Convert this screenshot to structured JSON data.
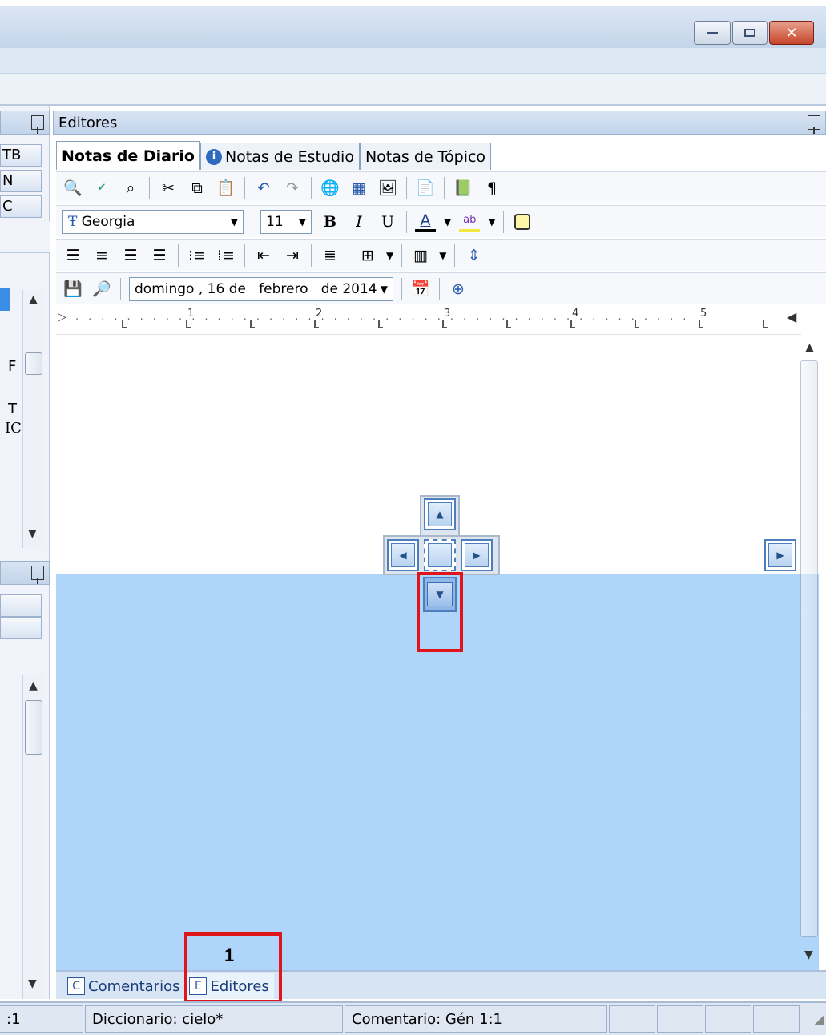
{
  "window": {
    "minimize_icon": "minimize-icon",
    "restore_icon": "restore-icon",
    "close_icon": "close-icon"
  },
  "left_pane": {
    "buttons": [
      "TB",
      "N",
      "C"
    ],
    "partial_text": [
      "F",
      "T",
      "IC"
    ]
  },
  "editors_pane": {
    "title": "Editores",
    "tabs": [
      {
        "label": "Notas de Diario",
        "active": true
      },
      {
        "label": "Notas de Estudio",
        "icon": "info-icon"
      },
      {
        "label": "Notas de Tópico"
      }
    ],
    "font_name": "Georgia",
    "font_size": "11",
    "bold": "B",
    "italic": "I",
    "underline": "U",
    "font_color": "A",
    "highlight": "ab",
    "pilcrow": "¶",
    "date_value": "domingo , 16 de   febrero   de 2014",
    "ruler_numbers": [
      "1",
      "2",
      "3",
      "4",
      "5"
    ],
    "drop_zone_color": "#b0d5fb",
    "annotation_number": "1"
  },
  "bottom_tabs": [
    {
      "letter": "C",
      "label": "Comentarios"
    },
    {
      "letter": "E",
      "label": "Editores"
    }
  ],
  "status_bar": {
    "left": ":1",
    "dictionary": "Diccionario: cielo*",
    "comment": "Comentario: Gén 1:1"
  }
}
